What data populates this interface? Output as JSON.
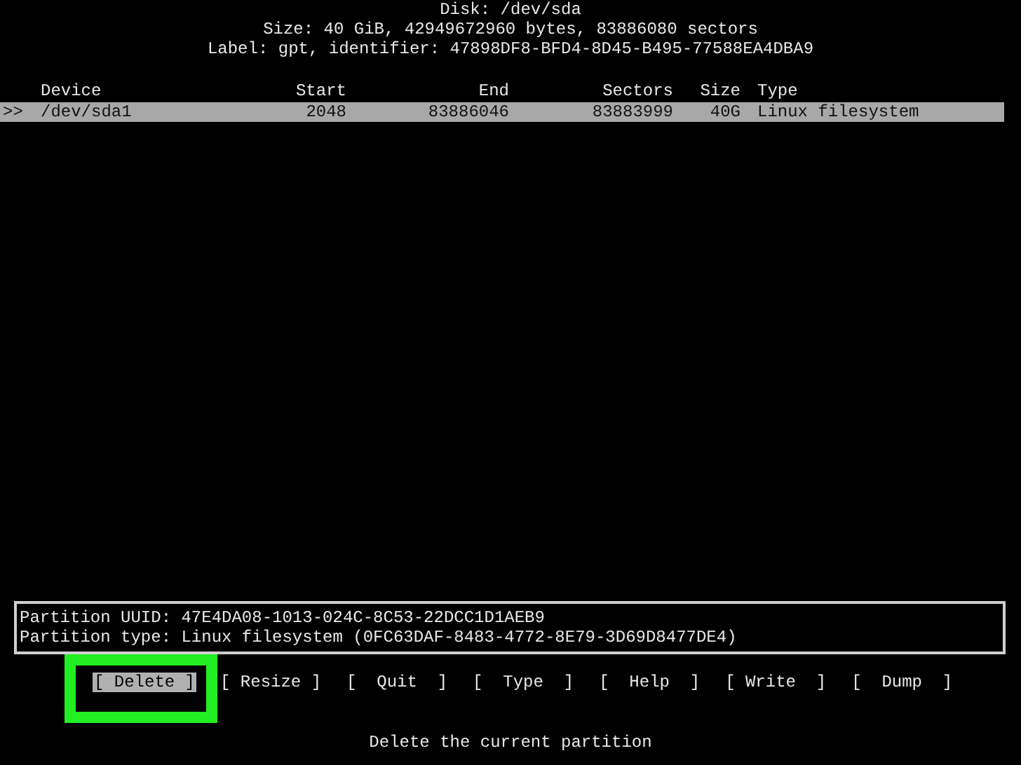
{
  "header": [
    "Disk: /dev/sda",
    "Size: 40 GiB, 42949672960 bytes, 83886080 sectors",
    "Label: gpt, identifier: 47898DF8-BFD4-8D45-B495-77588EA4DBA9"
  ],
  "table": {
    "columns": [
      "Device",
      "Start",
      "End",
      "Sectors",
      "Size",
      "Type"
    ],
    "rows": [
      {
        "marker": ">>",
        "cells": [
          "/dev/sda1",
          "2048",
          "83886046",
          "83883999",
          "40G",
          "Linux filesystem"
        ],
        "selected": true
      }
    ]
  },
  "info": [
    "Partition UUID: 47E4DA08-1013-024C-8C53-22DCC1D1AEB9",
    "Partition type: Linux filesystem (0FC63DAF-8483-4772-8E79-3D69D8477DE4)"
  ],
  "buttons": [
    {
      "label": "[ Delete ]",
      "selected": true
    },
    {
      "label": "[ Resize ]",
      "selected": false
    },
    {
      "label": "[  Quit  ]",
      "selected": false
    },
    {
      "label": "[  Type  ]",
      "selected": false
    },
    {
      "label": "[  Help  ]",
      "selected": false
    },
    {
      "label": "[ Write  ]",
      "selected": false
    },
    {
      "label": "[  Dump  ]",
      "selected": false
    }
  ],
  "status": "Delete the current partition"
}
